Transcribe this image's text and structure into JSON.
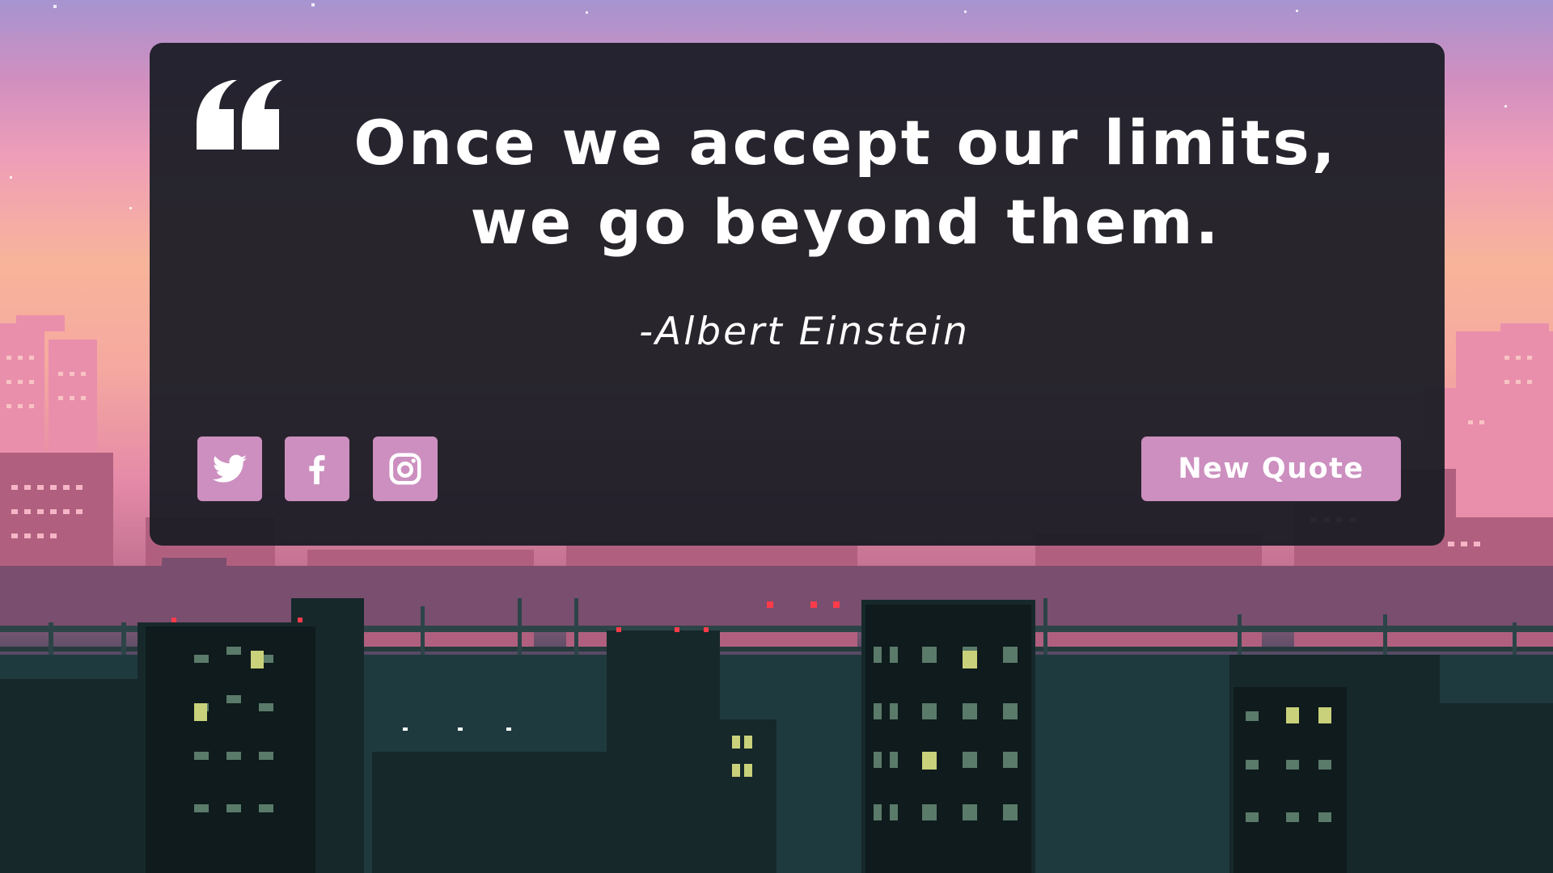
{
  "quote": {
    "mark_icon": "quote-left-icon",
    "text": "Once we accept our limits, we go beyond them.",
    "author": "-Albert Einstein"
  },
  "share": {
    "twitter_icon": "twitter-icon",
    "facebook_icon": "facebook-icon",
    "instagram_icon": "instagram-icon"
  },
  "actions": {
    "new_quote_label": "New Quote"
  },
  "theme": {
    "card_background": "#181b23",
    "accent": "#cc8fbf",
    "text": "#ffffff"
  }
}
